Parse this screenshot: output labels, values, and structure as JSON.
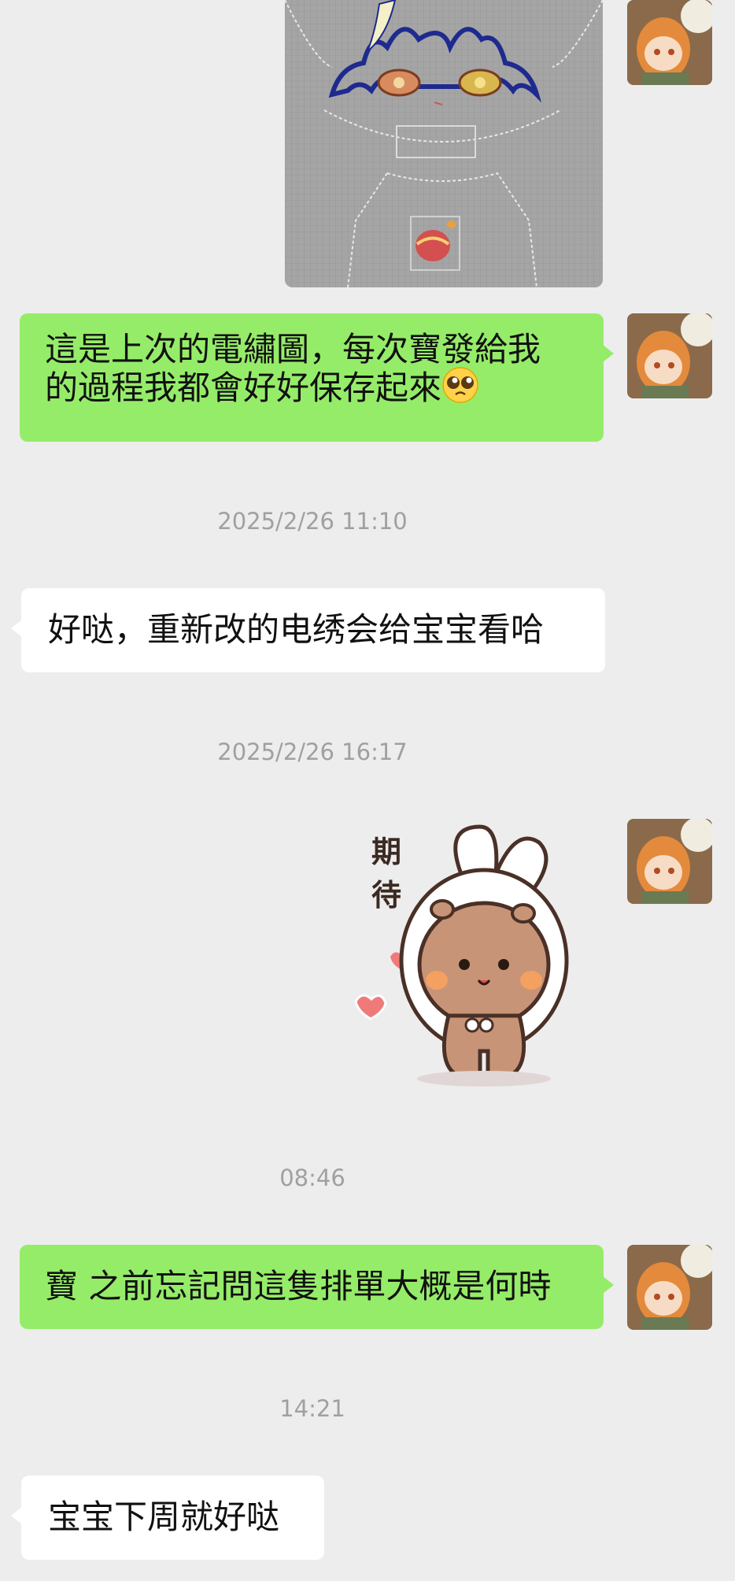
{
  "messages": [
    {
      "type": "image",
      "direction": "outgoing",
      "description_icon": "embroidery-design-image"
    },
    {
      "type": "text",
      "direction": "outgoing",
      "text_line1": "這是上次的電繡圖，每次寶發給我",
      "text_line2": "的過程我都會好好保存起來",
      "emoji": "pleading-face-emoji"
    },
    {
      "type": "timestamp",
      "text": "2025/2/26 11:10"
    },
    {
      "type": "text",
      "direction": "incoming",
      "text": "好哒，重新改的电绣会给宝宝看哈"
    },
    {
      "type": "timestamp",
      "text": "2025/2/26 16:17"
    },
    {
      "type": "sticker",
      "direction": "outgoing",
      "caption": "期待"
    },
    {
      "type": "timestamp",
      "text": "08:46"
    },
    {
      "type": "text",
      "direction": "outgoing",
      "text": "寶 之前忘記問這隻排單大概是何時"
    },
    {
      "type": "timestamp",
      "text": "14:21"
    },
    {
      "type": "text",
      "direction": "incoming",
      "text": "宝宝下周就好哒"
    }
  ],
  "colors": {
    "background": "#ededed",
    "outgoing_bubble": "#95ec69",
    "incoming_bubble": "#ffffff",
    "timestamp_text": "#a0a0a0"
  }
}
